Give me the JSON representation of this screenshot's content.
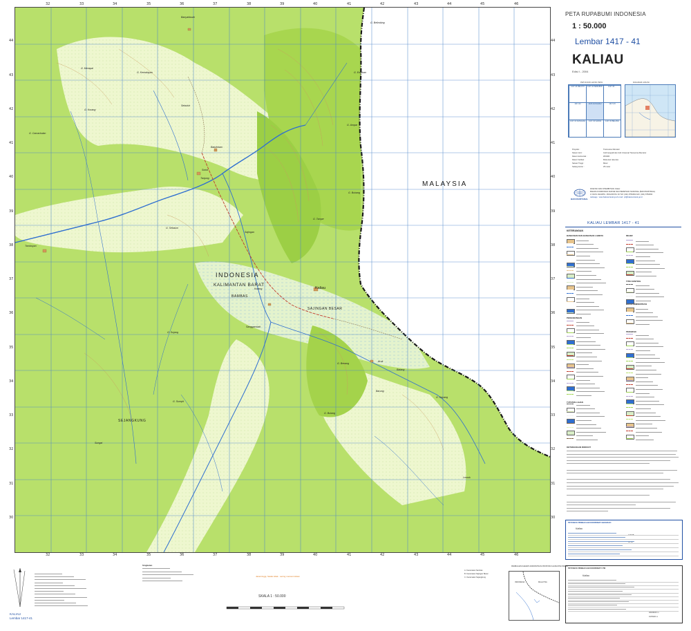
{
  "header": {
    "series": "PETA RUPABUMI INDONESIA",
    "scale": "1 : 50.000",
    "sheet": "Lembar 1417 - 41",
    "sheet_name": "KALIAU",
    "edition": "Edisi I - 2004"
  },
  "map": {
    "labels": {
      "malaysia": "MALAYSIA",
      "indonesia": "INDONESIA",
      "province": "KALIMANTAN BARAT",
      "district_bambas": "BAMBAS",
      "district_sajingan": "SAJINGAN BESAR",
      "district_sejangkung": "SEJANGKUNG",
      "town_kaliau": "Kaliau"
    },
    "places": [
      "G. Belimbing",
      "Banyakbuah",
      "G. Merapai",
      "G. Kemalayan",
      "G. Enteban",
      "G. Korang",
      "G. Camarbulan",
      "Sebuluh",
      "Batulintam",
      "Tanjung",
      "Sotok",
      "Tamboyan",
      "G. Sebaum",
      "G. Ampar",
      "G. Bukang",
      "G. Tampe",
      "Sajingan",
      "Kotang",
      "G. Sujang",
      "Sanggambak",
      "G. Benang",
      "Barung",
      "G. Sumpit",
      "G. Bulang",
      "G. Kayang",
      "Batang",
      "Lemok",
      "Aruk",
      "Sungai"
    ],
    "ticks_top": [
      "32",
      "33",
      "34",
      "35",
      "36",
      "37",
      "38",
      "39",
      "40",
      "41",
      "42",
      "43",
      "44",
      "45",
      "46"
    ],
    "ticks_left": [
      "44",
      "43",
      "42",
      "41",
      "40",
      "39",
      "38",
      "37",
      "36",
      "35",
      "34",
      "33",
      "32",
      "31",
      "30"
    ]
  },
  "index": {
    "title_left": "PETUNJUK LETAK PETA",
    "title_right": "DIAGRAM LOKASI",
    "cells": [
      "1417-43 MELAYU",
      "1417-44 SEMABOK",
      "1417-32 ...",
      "1417-42",
      "1417-41 KALIAU",
      "1417-33",
      "1417-31 SANGGAU",
      "1417-32 SARAS",
      "1417-34 BELANG"
    ]
  },
  "publisher": {
    "name": "DICETAK DAN DITERBITKAN OLEH :",
    "agency": "BADAN KOORDINASI SURVEI DAN PEMETAAN NASIONAL (BAKOSURTANAL)",
    "address": "Jl. RAYA JAKARTA - BOGOR KM. 46 TLP. (021) 8752062 FAX. (021) 8752063",
    "web": "webpage : www.bakosurtanal.go.id  email : pil@bakosurtanal.go.id",
    "logo": "BAKOSURTANAL"
  },
  "legend": {
    "sheet_ref": "KALIAU  LEMBAR  1417 - 41",
    "title": "KETERANGAN",
    "sections": [
      "BANGUNAN DAN BANGUNAN LAINNYA",
      "PERHUBUNGAN",
      "TUTUPAN LAHAN",
      "RELIEF",
      "TITIK KONTROL",
      "BATAS ADMINISTRASI",
      "PERAIRAN"
    ],
    "info_title": "KETERANGAN RIWAYAT"
  },
  "coordinates": {
    "geo_title": "PETUNJUK PEMBACAAN KOORDINAT GEOGRAFI",
    "utm_title": "PETUNJUK PEMBACAAN KOORDINAT UTM",
    "example_place": "Kaliau",
    "lon_example": "109°38'",
    "lat_example": "01°16'",
    "utm_e": "32449100 m",
    "utm_n": "0178100 m"
  },
  "footer": {
    "scale_label": "SKALA 1 : 50.000",
    "north_label": "KALIAU",
    "north_sheet": "Lembar 1417-41",
    "admin_title": "PEMBAGIAN DAERAH ADMINISTRASI PROPINSI KALIMANTAN BARAT",
    "admin_items": [
      "A. Kecamatan Sambas",
      "B. Kecamatan Sajingan Besar",
      "C. Kecamatan Sejangkung"
    ],
    "diagram_labels": [
      "INDONESIA",
      "MALAYSIA"
    ],
    "subdivision": "Singkatan"
  },
  "colors": {
    "forest": "#b9e36f",
    "forest_dark": "#9fd44e",
    "shrub": "#e2f2b8",
    "swamp": "#d8edc6",
    "river": "#2f6fd0",
    "contour": "#c8a06a",
    "grid": "#4b84c9",
    "border": "#1a1a1a",
    "title_blue": "#1f4fa3"
  }
}
